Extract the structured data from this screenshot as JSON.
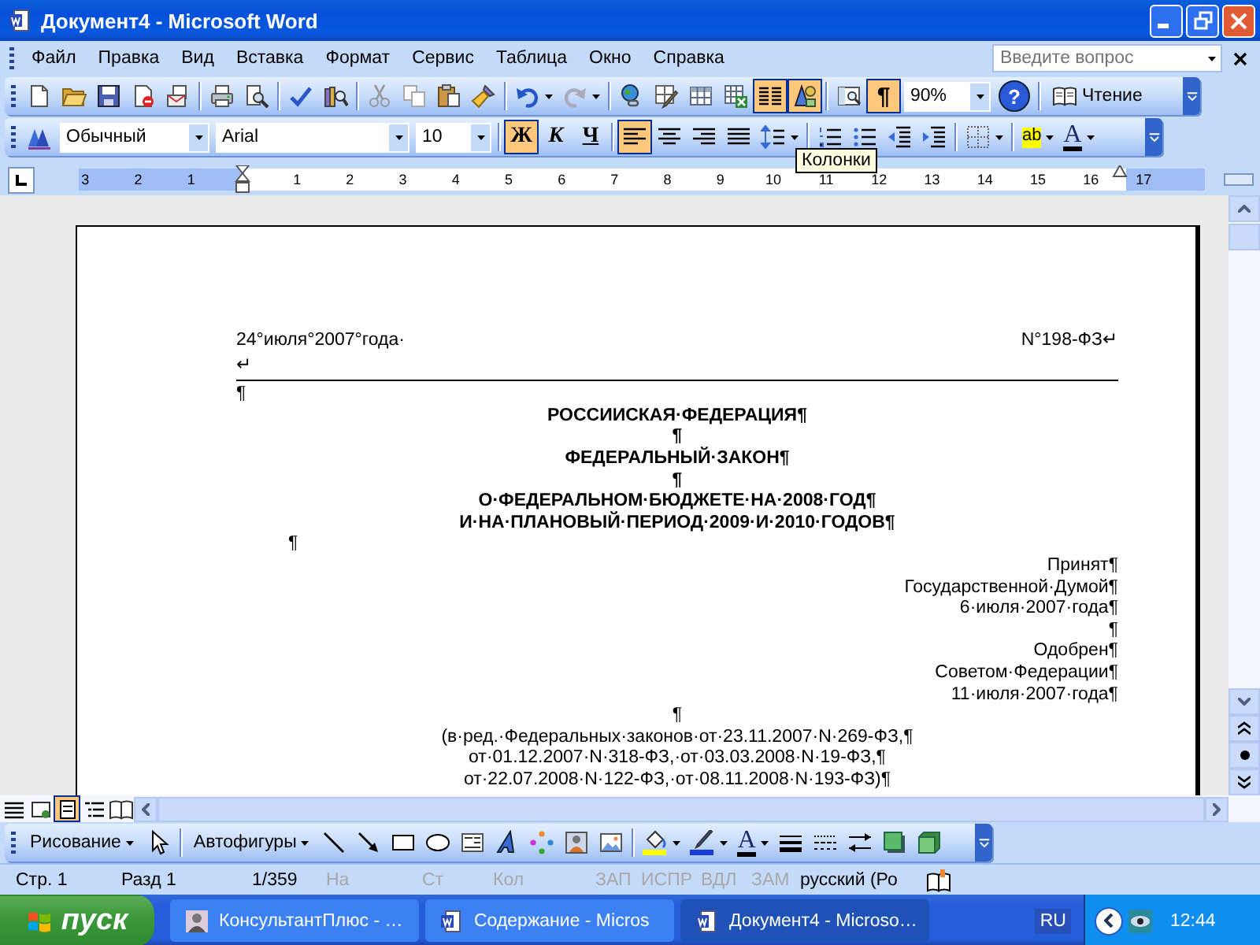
{
  "window": {
    "title": "Документ4 - Microsoft Word"
  },
  "menu": {
    "items": [
      "Файл",
      "Правка",
      "Вид",
      "Вставка",
      "Формат",
      "Сервис",
      "Таблица",
      "Окно",
      "Справка"
    ],
    "help_search": {
      "placeholder": "Введите вопрос"
    }
  },
  "standard_toolbar": {
    "buttons": [
      {
        "pressed": false
      },
      {
        "pressed": false
      },
      {
        "pressed": false
      },
      {
        "pressed": false
      },
      {
        "pressed": false
      },
      {
        "pressed": false
      },
      {
        "pressed": false
      },
      {
        "pressed": false
      },
      {
        "pressed": false
      },
      {
        "pressed": false
      },
      {
        "pressed": false
      },
      {
        "pressed": false
      },
      {
        "pressed": false
      },
      {
        "pressed": false
      },
      {
        "pressed": false
      },
      {
        "pressed": false
      },
      {
        "pressed": false
      },
      {
        "pressed": false
      },
      {
        "pressed": false
      },
      {
        "pressed": true
      },
      {
        "pressed": true
      },
      {
        "pressed": false
      },
      {
        "label": "¶",
        "pressed": true
      }
    ],
    "zoom": "90%",
    "help_label": "?",
    "read_button": "Чтение"
  },
  "formatting_toolbar": {
    "style": "Обычный",
    "font": "Arial",
    "size": "10",
    "buttons": [
      {
        "label": "Ж",
        "pressed": true
      },
      {
        "label": "К",
        "pressed": false
      },
      {
        "label": "Ч",
        "pressed": false
      },
      {
        "pressed": true
      },
      {
        "pressed": false
      },
      {
        "pressed": false
      },
      {
        "pressed": false
      },
      {
        "pressed": false
      },
      {
        "pressed": false
      },
      {
        "pressed": false
      },
      {
        "pressed": false
      },
      {
        "pressed": false
      },
      {
        "pressed": false
      },
      {
        "label": "ab",
        "pressed": false
      },
      {
        "label": "A",
        "pressed": false
      }
    ]
  },
  "tooltip": "Колонки",
  "ruler": {
    "labels": [
      "3",
      "2",
      "1",
      "1",
      "2",
      "3",
      "4",
      "5",
      "6",
      "7",
      "8",
      "9",
      "10",
      "11",
      "12",
      "13",
      "14",
      "15",
      "16",
      "17"
    ]
  },
  "document": {
    "paragraphs": [
      {
        "kind": "split",
        "left": "24°июля°2007°года·",
        "right": "N°198-ФЗ↵"
      },
      {
        "kind": "left",
        "text": "↵",
        "bold": false
      },
      {
        "kind": "rule"
      },
      {
        "kind": "left",
        "text": "¶",
        "bold": false
      },
      {
        "kind": "center",
        "text": "РОССИИСКАЯ·ФЕДЕРАЦИЯ¶",
        "bold": true
      },
      {
        "kind": "center",
        "text": "¶",
        "bold": true
      },
      {
        "kind": "center",
        "text": "ФЕДЕРАЛЬНЫЙ·ЗАКОН¶",
        "bold": true
      },
      {
        "kind": "center",
        "text": "¶",
        "bold": true
      },
      {
        "kind": "center",
        "text": "О·ФЕДЕРАЛЬНОМ·БЮДЖЕТЕ·НА·2008·ГОД¶",
        "bold": true
      },
      {
        "kind": "center",
        "text": "И·НА·ПЛАНОВЫЙ·ПЕРИОД·2009·И·2010·ГОДОВ¶",
        "bold": true
      },
      {
        "kind": "indent",
        "text": "¶",
        "bold": false
      },
      {
        "kind": "right",
        "text": "Принят¶",
        "bold": false
      },
      {
        "kind": "right",
        "text": "Государственной·Думой¶",
        "bold": false
      },
      {
        "kind": "right",
        "text": "6·июля·2007·года¶",
        "bold": false
      },
      {
        "kind": "right",
        "text": "¶",
        "bold": false
      },
      {
        "kind": "right",
        "text": "Одобрен¶",
        "bold": false
      },
      {
        "kind": "right",
        "text": "Советом·Федерации¶",
        "bold": false
      },
      {
        "kind": "right",
        "text": "11·июля·2007·года¶",
        "bold": false
      },
      {
        "kind": "center",
        "text": "¶",
        "bold": false
      },
      {
        "kind": "center",
        "text": "(в·ред.·Федеральных·законов·от·23.11.2007·N·269-ФЗ,¶",
        "bold": false
      },
      {
        "kind": "center",
        "text": "от·01.12.2007·N·318-ФЗ,·от·03.03.2008·N·19-ФЗ,¶",
        "bold": false
      },
      {
        "kind": "center",
        "text": "от·22.07.2008·N·122-ФЗ,·от·08.11.2008·N·193-ФЗ)¶",
        "bold": false
      }
    ]
  },
  "view_buttons": [
    {
      "selected": false
    },
    {
      "selected": false
    },
    {
      "selected": true
    },
    {
      "selected": false
    },
    {
      "selected": false
    }
  ],
  "drawing_toolbar": {
    "draw_menu": "Рисование",
    "autoshapes_menu": "Автофигуры",
    "font_color_label": "A"
  },
  "status_bar": {
    "items": [
      {
        "text": "Стр. 1",
        "disabled": false
      },
      {
        "text": "Разд 1",
        "disabled": false
      },
      {
        "text": "1/359",
        "disabled": false
      },
      {
        "text": "На",
        "disabled": true
      },
      {
        "text": "Ст",
        "disabled": true
      },
      {
        "text": "Кол",
        "disabled": true
      },
      {
        "text": "ЗАП",
        "disabled": true
      },
      {
        "text": "ИСПР",
        "disabled": true
      },
      {
        "text": "ВДЛ",
        "disabled": true
      },
      {
        "text": "ЗАМ",
        "disabled": true
      },
      {
        "text": "русский (Ро",
        "disabled": false
      }
    ]
  },
  "taskbar": {
    "start": "пуск",
    "tasks": [
      {
        "title": "КонсультантПлюс - …",
        "selected": false
      },
      {
        "title": "Содержание - Micros",
        "selected": false
      },
      {
        "title": "Документ4 - Microso…",
        "selected": true
      }
    ],
    "language": "RU",
    "clock": "12:44"
  }
}
